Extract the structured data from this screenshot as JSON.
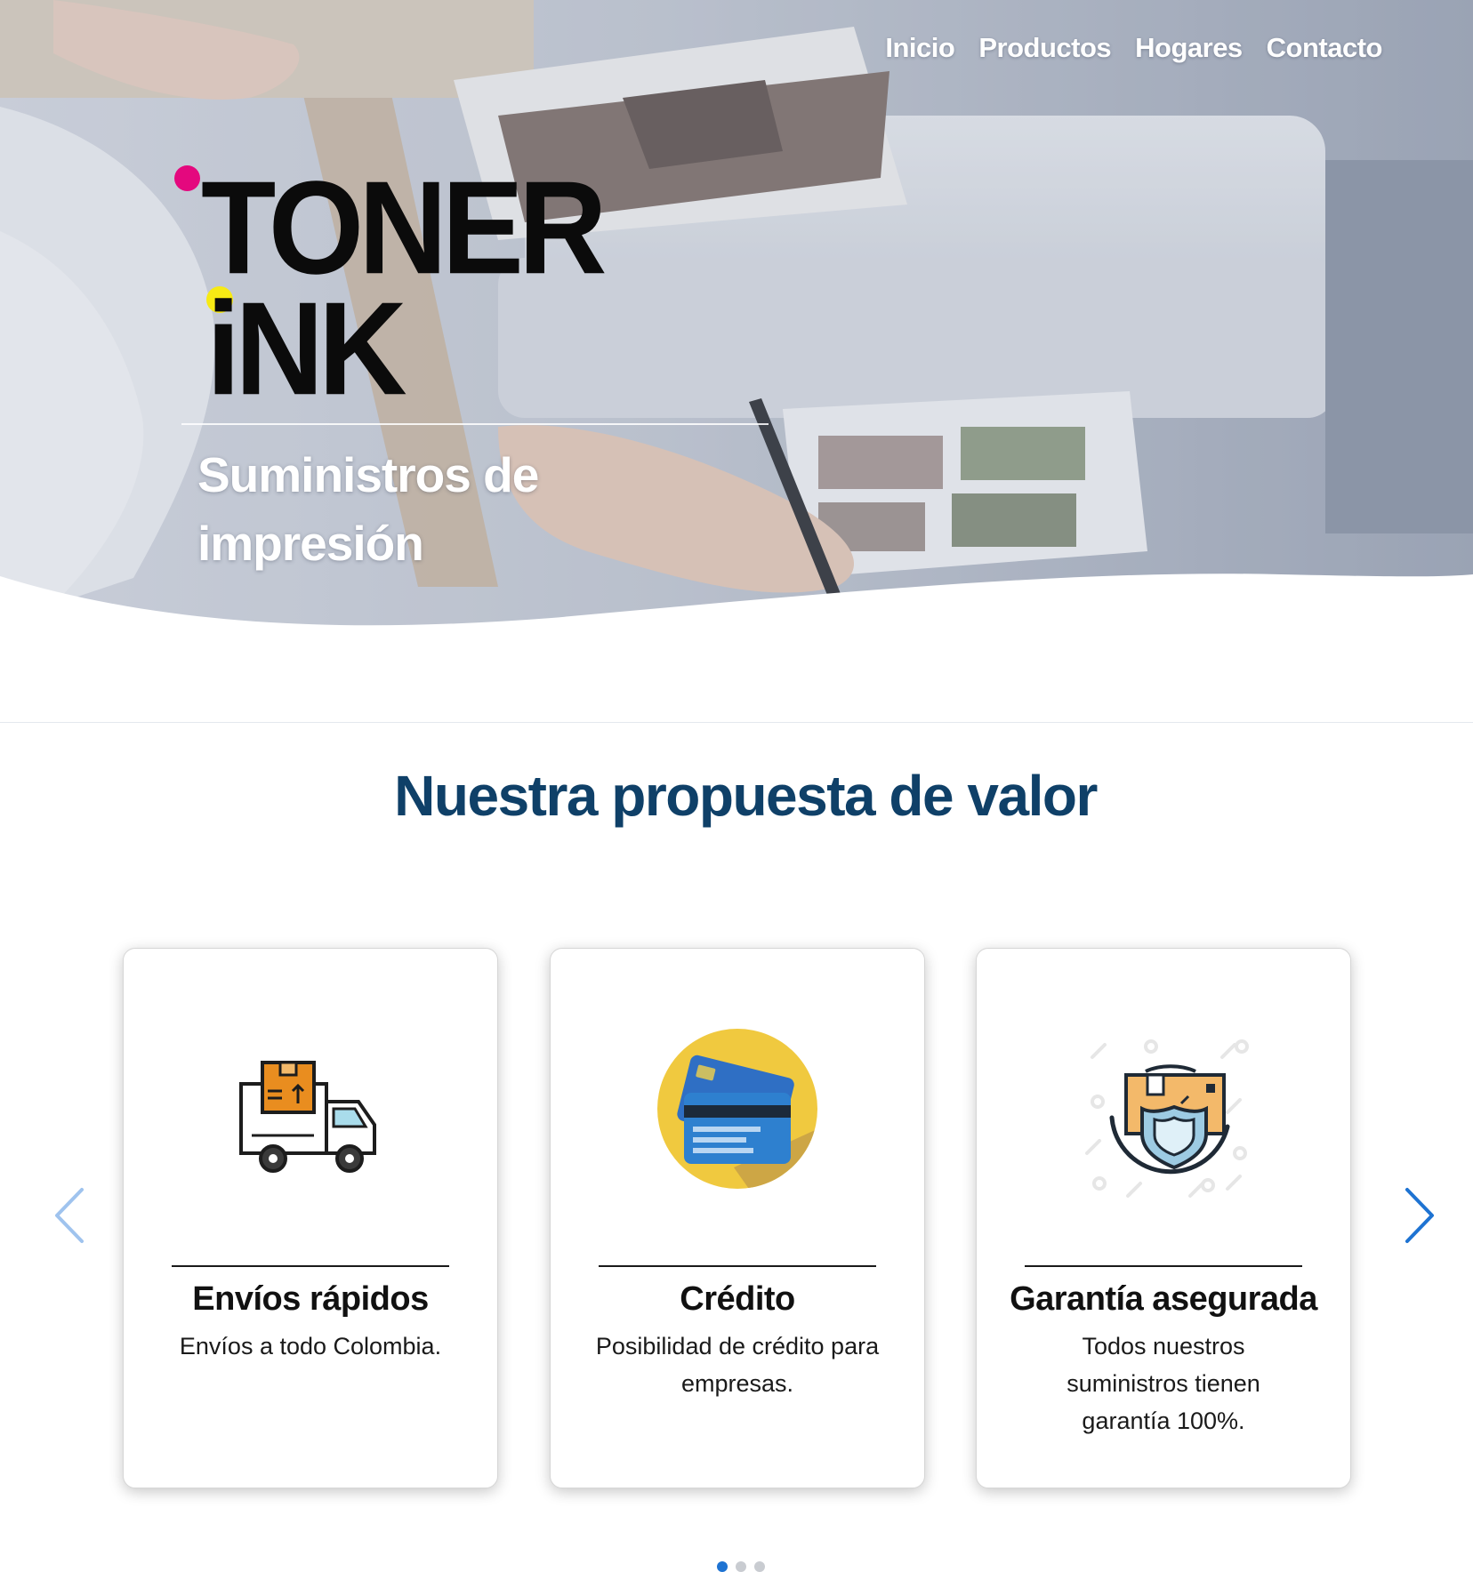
{
  "nav": {
    "items": [
      {
        "label": "Inicio"
      },
      {
        "label": "Productos"
      },
      {
        "label": "Hogares"
      },
      {
        "label": "Contacto"
      }
    ]
  },
  "hero": {
    "logo_line1": "TONER",
    "logo_line2": "iNK",
    "tagline": "Suministros de impresión",
    "image_icon": "printer-photo-background"
  },
  "section": {
    "title": "Nuestra propuesta de valor"
  },
  "cards": [
    {
      "icon": "delivery-truck-icon",
      "title": "Envíos rápidos",
      "description": "Envíos a todo Colombia."
    },
    {
      "icon": "credit-card-icon",
      "title": "Crédito",
      "description": "Posibilidad de crédito para empresas."
    },
    {
      "icon": "shield-box-icon",
      "title": "Garantía asegurada",
      "description": "Todos nuestros suministros tienen garantía 100%."
    }
  ],
  "carousel": {
    "prev_icon": "chevron-left-icon",
    "next_icon": "chevron-right-icon",
    "slide_count": 3,
    "active_slide": 1
  },
  "colors": {
    "title_blue": "#0f4068",
    "accent_blue": "#1e73d2",
    "magenta": "#e4087e",
    "yellow": "#f7ea14",
    "card_icon_yellow": "#f0c93f",
    "card_icon_blue": "#2e73c4",
    "box_orange": "#e98d1f",
    "box_tan": "#f3b96a"
  }
}
